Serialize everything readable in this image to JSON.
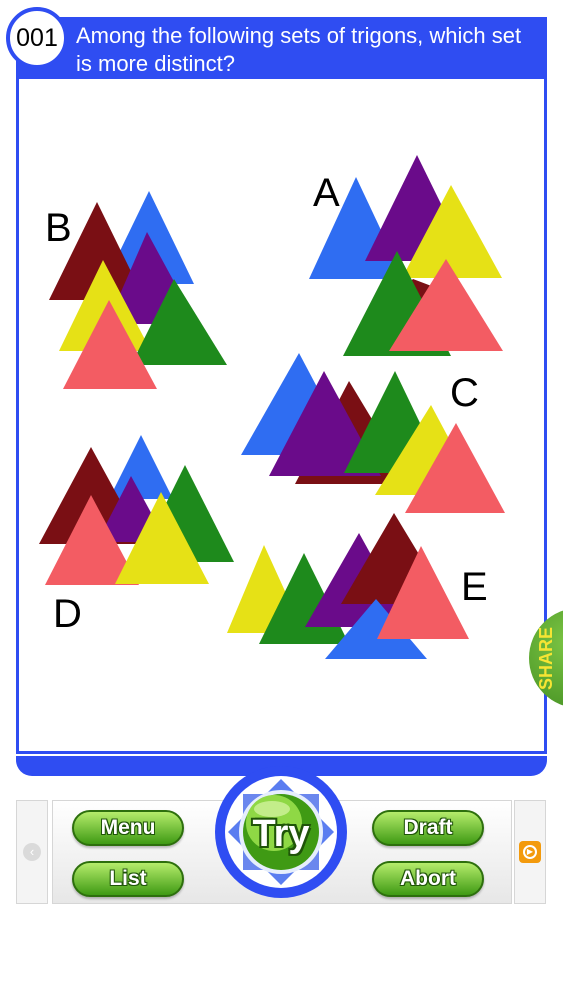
{
  "question": {
    "number": "001",
    "text": "Among the following sets of trigons, which set is more distinct?"
  },
  "figure": {
    "sets": [
      {
        "label": "A",
        "colors": [
          "#2f6df2",
          "#6a0b8a",
          "#e6e116",
          "#7a0f14",
          "#1e8a1c",
          "#f35c63"
        ]
      },
      {
        "label": "B",
        "colors": [
          "#7a0f14",
          "#2f6df2",
          "#6a0b8a",
          "#e6e116",
          "#1e8a1c",
          "#f35c63"
        ]
      },
      {
        "label": "C",
        "colors": [
          "#2f6df2",
          "#6a0b8a",
          "#7a0f14",
          "#1e8a1c",
          "#e6e116",
          "#f35c63"
        ]
      },
      {
        "label": "D",
        "colors": [
          "#7a0f14",
          "#2f6df2",
          "#6a0b8a",
          "#1e8a1c",
          "#f35c63",
          "#e6e116"
        ]
      },
      {
        "label": "E",
        "colors": [
          "#e6e116",
          "#1e8a1c",
          "#6a0b8a",
          "#7a0f14",
          "#2f6df2",
          "#f35c63"
        ]
      }
    ]
  },
  "share_label": "SHARE",
  "controls": {
    "menu": "Menu",
    "list": "List",
    "try": "Try",
    "draft": "Draft",
    "abort": "Abort"
  },
  "colors": {
    "accent_blue": "#2f4df2",
    "button_green": "#3f9a14",
    "share_text": "#f6e433"
  }
}
